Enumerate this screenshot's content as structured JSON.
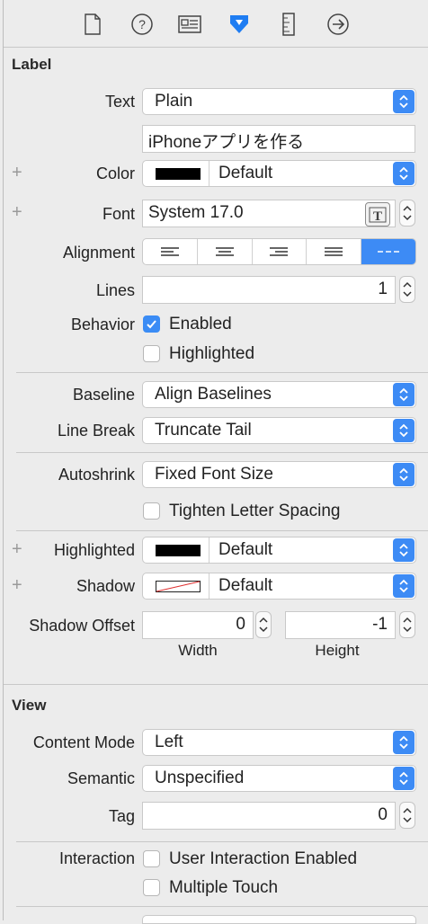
{
  "toolbar": {
    "icons": [
      "file-icon",
      "help-icon",
      "identity-icon",
      "attributes-icon",
      "ruler-icon",
      "connections-icon"
    ],
    "accent": "#3d8bf5"
  },
  "label_section": {
    "title": "Label",
    "text": {
      "label": "Text",
      "value": "Plain",
      "content": "iPhoneアプリを作る"
    },
    "color": {
      "label": "Color",
      "value": "Default"
    },
    "font": {
      "label": "Font",
      "value": "System 17.0"
    },
    "alignment": {
      "label": "Alignment",
      "options": [
        "left",
        "center",
        "right",
        "justified",
        "natural"
      ],
      "selected": "natural"
    },
    "lines": {
      "label": "Lines",
      "value": "1"
    },
    "behavior": {
      "label": "Behavior",
      "enabled": "Enabled",
      "enabled_checked": true,
      "highlighted": "Highlighted",
      "highlighted_checked": false
    },
    "baseline": {
      "label": "Baseline",
      "value": "Align Baselines"
    },
    "line_break": {
      "label": "Line Break",
      "value": "Truncate Tail"
    },
    "autoshrink": {
      "label": "Autoshrink",
      "value": "Fixed Font Size",
      "tighten": "Tighten Letter Spacing",
      "tighten_checked": false
    },
    "highlighted": {
      "label": "Highlighted",
      "value": "Default"
    },
    "shadow": {
      "label": "Shadow",
      "value": "Default"
    },
    "shadow_offset": {
      "label": "Shadow Offset",
      "width": "0",
      "height": "-1",
      "width_caption": "Width",
      "height_caption": "Height"
    }
  },
  "view_section": {
    "title": "View",
    "content_mode": {
      "label": "Content Mode",
      "value": "Left"
    },
    "semantic": {
      "label": "Semantic",
      "value": "Unspecified"
    },
    "tag": {
      "label": "Tag",
      "value": "0"
    },
    "interaction": {
      "label": "Interaction",
      "user_interaction": "User Interaction Enabled",
      "multiple_touch": "Multiple Touch"
    }
  }
}
